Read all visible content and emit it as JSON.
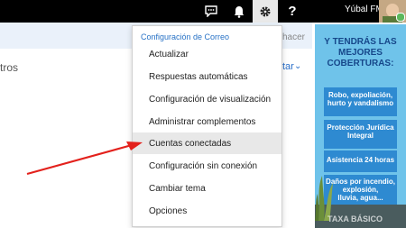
{
  "topbar": {
    "user_name": "Yúbal FM",
    "help_label": "?"
  },
  "band": {
    "text": "hacer"
  },
  "left": {
    "text": "tros"
  },
  "right": {
    "text": "tar"
  },
  "menu": {
    "header": "Configuración de Correo",
    "items": [
      {
        "label": "Actualizar"
      },
      {
        "label": "Respuestas automáticas"
      },
      {
        "label": "Configuración de visualización"
      },
      {
        "label": "Administrar complementos"
      },
      {
        "label": "Cuentas conectadas"
      },
      {
        "label": "Configuración sin conexión"
      },
      {
        "label": "Cambiar tema"
      },
      {
        "label": "Opciones"
      }
    ],
    "active_index": 4
  },
  "ad": {
    "title_lines": [
      "Y TENDRÁS LAS",
      "MEJORES",
      "COBERTURAS:"
    ],
    "cards": [
      {
        "lines": [
          "Robo, expoliación,",
          "hurto y vandalismo"
        ]
      },
      {
        "lines": [
          "Protección Jurídica",
          "Integral"
        ]
      },
      {
        "lines": [
          "Asistencia 24 horas"
        ]
      },
      {
        "lines": [
          "Daños por incendio,",
          "explosión,",
          "lluvia, agua..."
        ]
      }
    ],
    "footer_text": "TAXA BÁSICO"
  },
  "colors": {
    "topbar": "#000000",
    "accent": "#2872c6",
    "arrow": "#e3211c",
    "ad_bg": "#6fc3ea"
  }
}
